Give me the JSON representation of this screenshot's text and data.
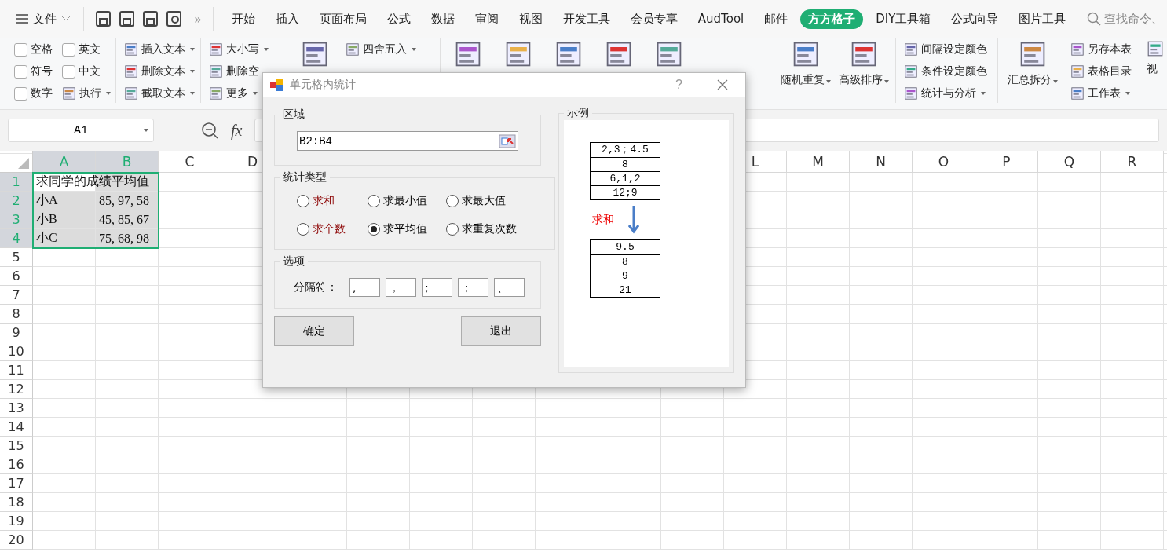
{
  "menu": {
    "file": "文件",
    "overflow": "»"
  },
  "tabs": [
    {
      "label": "开始",
      "selected": false
    },
    {
      "label": "插入",
      "selected": false
    },
    {
      "label": "页面布局",
      "selected": false
    },
    {
      "label": "公式",
      "selected": false
    },
    {
      "label": "数据",
      "selected": false
    },
    {
      "label": "审阅",
      "selected": false
    },
    {
      "label": "视图",
      "selected": false
    },
    {
      "label": "开发工具",
      "selected": false
    },
    {
      "label": "会员专享",
      "selected": false
    },
    {
      "label": "AudTool",
      "selected": false
    },
    {
      "label": "邮件",
      "selected": false
    },
    {
      "label": "方方格子",
      "selected": true
    },
    {
      "label": "DIY工具箱",
      "selected": false
    },
    {
      "label": "公式向导",
      "selected": false
    },
    {
      "label": "图片工具",
      "selected": false
    }
  ],
  "search": {
    "placeholder": "查找命令、"
  },
  "ribbon": [
    {
      "kind": "checks",
      "items": [
        {
          "kind": "checkbox",
          "label": "空格",
          "checked": false
        },
        {
          "kind": "checkbox",
          "label": "符号",
          "checked": false
        },
        {
          "kind": "checkbox",
          "label": "数字",
          "checked": false
        },
        {
          "kind": "checkbox",
          "label": "英文",
          "checked": false
        },
        {
          "kind": "checkbox",
          "label": "中文",
          "checked": false
        },
        {
          "kind": "small",
          "label": "执行",
          "dropdown": true
        }
      ]
    },
    {
      "kind": "smalls",
      "items": [
        {
          "kind": "small",
          "label": "插入文本",
          "dropdown": true
        },
        {
          "kind": "small",
          "label": "删除文本",
          "dropdown": true
        },
        {
          "kind": "small",
          "label": "截取文本",
          "dropdown": true
        }
      ]
    },
    {
      "kind": "smalls",
      "items": [
        {
          "kind": "small",
          "label": "大小写",
          "dropdown": true
        },
        {
          "kind": "small",
          "label": "删除空"
        },
        {
          "kind": "small",
          "label": "更多",
          "dropdown": true
        }
      ]
    },
    {
      "kind": "mixed",
      "items": [
        {
          "kind": "big"
        },
        {
          "kind": "small",
          "label": "四舍五入",
          "dropdown": true
        }
      ]
    },
    {
      "kind": "bigs",
      "items": [
        {
          "kind": "big"
        },
        {
          "kind": "big"
        },
        {
          "kind": "big"
        },
        {
          "kind": "big"
        },
        {
          "kind": "big"
        }
      ]
    },
    {
      "kind": "bigs",
      "items": [
        {
          "kind": "big",
          "label": "随机重复",
          "dropdown": true
        },
        {
          "kind": "big",
          "label": "高级排序",
          "dropdown": true
        }
      ]
    },
    {
      "kind": "smalls",
      "items": [
        {
          "kind": "small",
          "label": "间隔设定颜色"
        },
        {
          "kind": "small",
          "label": "条件设定颜色"
        },
        {
          "kind": "small",
          "label": "统计与分析",
          "dropdown": true
        }
      ]
    },
    {
      "kind": "mixed",
      "items": [
        {
          "kind": "big",
          "label": "汇总拆分",
          "dropdown": true
        },
        {
          "kind": "small",
          "label": "另存本表"
        },
        {
          "kind": "small",
          "label": "表格目录"
        },
        {
          "kind": "small",
          "label": "工作表",
          "dropdown": true
        }
      ]
    },
    {
      "kind": "bigs",
      "items": [
        {
          "kind": "big",
          "label": "视"
        }
      ]
    }
  ],
  "formula_bar": {
    "name_box": "A1",
    "fx": "fx"
  },
  "sheet": {
    "columns_left": [
      {
        "label": "A",
        "selected": true
      },
      {
        "label": "B",
        "selected": true
      },
      {
        "label": "C",
        "selected": false
      },
      {
        "label": "D",
        "selected": false
      }
    ],
    "columns_right": [
      {
        "label": "L",
        "selected": false
      },
      {
        "label": "M",
        "selected": false
      },
      {
        "label": "N",
        "selected": false
      },
      {
        "label": "O",
        "selected": false
      },
      {
        "label": "P",
        "selected": false
      },
      {
        "label": "Q",
        "selected": false
      },
      {
        "label": "R",
        "selected": false
      }
    ],
    "rows": [
      {
        "label": "1",
        "selected": true
      },
      {
        "label": "2",
        "selected": true
      },
      {
        "label": "3",
        "selected": true
      },
      {
        "label": "4",
        "selected": true
      },
      {
        "label": "5",
        "selected": false
      },
      {
        "label": "6",
        "selected": false
      },
      {
        "label": "7",
        "selected": false
      },
      {
        "label": "8",
        "selected": false
      },
      {
        "label": "9",
        "selected": false
      },
      {
        "label": "10",
        "selected": false
      },
      {
        "label": "11",
        "selected": false
      },
      {
        "label": "12",
        "selected": false
      },
      {
        "label": "13",
        "selected": false
      },
      {
        "label": "14",
        "selected": false
      },
      {
        "label": "15",
        "selected": false
      },
      {
        "label": "16",
        "selected": false
      },
      {
        "label": "17",
        "selected": false
      },
      {
        "label": "18",
        "selected": false
      },
      {
        "label": "19",
        "selected": false
      },
      {
        "label": "20",
        "selected": false
      }
    ],
    "data": [
      [
        {
          "text": "求同学的成绩平均值",
          "active": true
        }
      ],
      [
        {
          "text": "小A",
          "active": false
        },
        {
          "text": "85, 97, 58",
          "active": false
        }
      ],
      [
        {
          "text": "小B",
          "active": false
        },
        {
          "text": "45, 85, 67",
          "active": false
        }
      ],
      [
        {
          "text": "小C",
          "active": false
        },
        {
          "text": "75, 68, 98",
          "active": false
        }
      ]
    ]
  },
  "dialog": {
    "title": "单元格内统计",
    "help": "?",
    "region": {
      "legend": "区域",
      "value": "B2:B4"
    },
    "stat_type": {
      "legend": "统计类型",
      "options": [
        {
          "label": "求和",
          "selected": false,
          "highlighted": true
        },
        {
          "label": "求最小值",
          "selected": false,
          "highlighted": false
        },
        {
          "label": "求最大值",
          "selected": false,
          "highlighted": false
        },
        {
          "label": "求个数",
          "selected": false,
          "highlighted": true
        },
        {
          "label": "求平均值",
          "selected": true,
          "highlighted": false
        },
        {
          "label": "求重复次数",
          "selected": false,
          "highlighted": false
        }
      ]
    },
    "options": {
      "legend": "选项",
      "separator_label": "分隔符：",
      "separators": [
        ",",
        "，",
        ";",
        "；",
        "、"
      ]
    },
    "buttons": [
      "确定",
      "退出"
    ],
    "example": {
      "legend": "示例",
      "before": [
        "2,3；4.5",
        "8",
        "6,1,2",
        "12;9"
      ],
      "operation": "求和",
      "after": [
        "9.5",
        "8",
        "9",
        "21"
      ]
    }
  }
}
